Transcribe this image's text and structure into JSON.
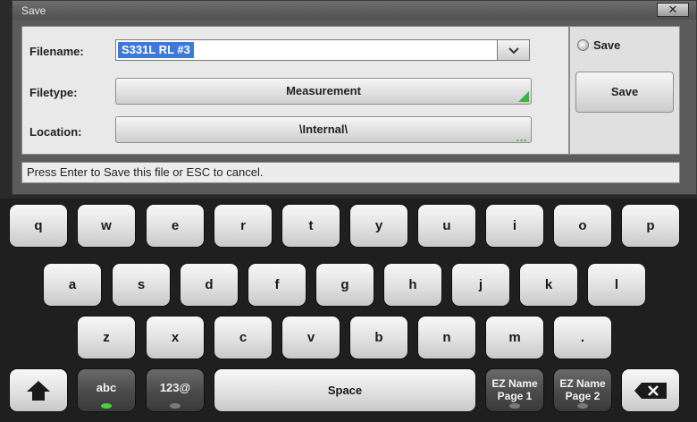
{
  "dialog": {
    "title": "Save",
    "close_label": "✕",
    "filename": {
      "label": "Filename:",
      "value": "S331L RL #3",
      "dropdown_icon": "chevron-down-icon"
    },
    "filetype": {
      "label": "Filetype:",
      "value": "Measurement"
    },
    "location": {
      "label": "Location:",
      "value": "\\Internal\\",
      "more_icon": "…"
    },
    "side": {
      "radio_label": "Save",
      "button_label": "Save"
    },
    "status": "Press Enter to Save this file or ESC to cancel."
  },
  "keyboard": {
    "row1": [
      "q",
      "w",
      "e",
      "r",
      "t",
      "y",
      "u",
      "i",
      "o",
      "p"
    ],
    "row2": [
      "a",
      "s",
      "d",
      "f",
      "g",
      "h",
      "j",
      "k",
      "l"
    ],
    "row3": [
      "z",
      "x",
      "c",
      "v",
      "b",
      "n",
      "m",
      "."
    ],
    "abc": "abc",
    "num": "123@",
    "space": "Space",
    "ez1_line1": "EZ Name",
    "ez1_line2": "Page 1",
    "ez2_line1": "EZ Name",
    "ez2_line2": "Page 2",
    "shift_icon": "shift-arrow-icon",
    "backspace_icon": "backspace-icon"
  },
  "colors": {
    "accent_green": "#3fb341",
    "selection_blue": "#3b7ad6",
    "led_on": "#43d43a"
  }
}
